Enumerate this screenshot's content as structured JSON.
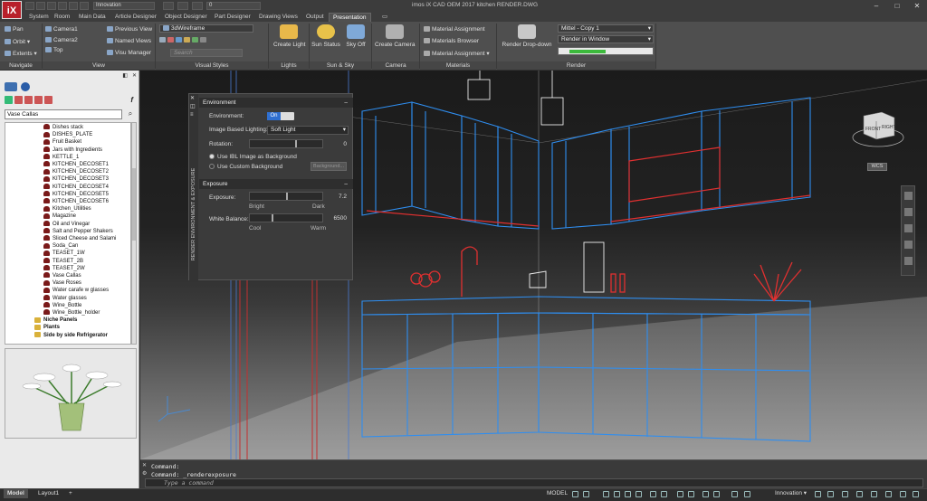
{
  "title_bar": {
    "app_logo": "iX",
    "workspace_dropdown": "Innovation",
    "layer_dropdown": "0",
    "title": "imos iX CAD OEM 2017   kitchen RENDER.DWG"
  },
  "ribbon_tabs": [
    "System",
    "Room",
    "Main Data",
    "Article Designer",
    "Object Designer",
    "Part Designer",
    "Drawing Views",
    "Output",
    "Presentation"
  ],
  "ribbon": {
    "navigate": {
      "pan": "Pan",
      "orbit": "Orbit",
      "extents": "Extents",
      "label": "Navigate"
    },
    "view": {
      "camera1": "Camera1",
      "camera2": "Camera2",
      "top": "Top",
      "previous_view": "Previous View",
      "named_views": "Named Views",
      "visu_manager": "Visu Manager",
      "label": "View"
    },
    "visual_styles": {
      "style": "3dWireframe",
      "search_placeholder": "Search",
      "label": "Visual Styles"
    },
    "lights": {
      "create_light": "Create Light",
      "label": "Lights"
    },
    "sun_sky": {
      "sun_status": "Sun Status",
      "sky_off": "Sky Off",
      "label": "Sun & Sky"
    },
    "camera": {
      "create_camera": "Create Camera",
      "label": "Camera"
    },
    "materials": {
      "assignment": "Material Assignment",
      "browser": "Materials Browser",
      "assignment2": "Material Assignment",
      "label": "Materials"
    },
    "render": {
      "render_dropdown": "Render Drop-down",
      "preset": "Mittel - Copy 1",
      "target": "Render in Window",
      "label": "Render"
    }
  },
  "left_panel": {
    "search_value": "Vase Callas",
    "tree_items": [
      "Dishes stack",
      "DISHES_PLATE",
      "Fruit Basket",
      "Jars with Ingredients",
      "KETTLE_1",
      "KITCHEN_DECOSET1",
      "KITCHEN_DECOSET2",
      "KITCHEN_DECOSET3",
      "KITCHEN_DECOSET4",
      "KITCHEN_DECOSET5",
      "KITCHEN_DECOSET6",
      "Kitchen_Utilities",
      "Magazine",
      "Oil and Vinegar",
      "Salt and Pepper Shakers",
      "Sliced Cheese and Salami",
      "Soda_Can",
      "TEASET_1W",
      "TEASET_2B",
      "TEASET_2W",
      "Vase Callas",
      "Vase Roses",
      "Water carafe w glasses",
      "Water glasses",
      "Wine_Bottle",
      "Wine_Bottle_holder"
    ],
    "tree_folders": [
      "Niche Panels",
      "Plants",
      "Side by side Refrigerator"
    ]
  },
  "render_panel": {
    "side_title": "RENDER ENVIRONMENT & EXPOSURE",
    "environment_header": "Environment",
    "environment_label": "Environment:",
    "environment_toggle": "On",
    "ibl_label": "Image Based Lighting:",
    "ibl_value": "Soft Light",
    "rotation_label": "Rotation:",
    "rotation_value": "0",
    "use_ibl_bg": "Use IBL Image as Background",
    "use_custom_bg": "Use Custom Background",
    "background_btn": "Background...",
    "exposure_header": "Exposure",
    "exposure_label": "Exposure:",
    "exposure_value": "7.2",
    "bright_label": "Bright",
    "dark_label": "Dark",
    "white_balance_label": "White Balance:",
    "white_balance_value": "6500",
    "cool_label": "Cool",
    "warm_label": "Warm"
  },
  "viewcube": {
    "front": "FRONT",
    "right": "RIGHT",
    "ucs": "WCS"
  },
  "command": {
    "line1": "Command:",
    "line2": "Command: _renderexposure",
    "placeholder": "Type a command"
  },
  "status_bar": {
    "model_tab": "Model",
    "layout_tab": "Layout1",
    "add_tab": "+",
    "model_indicator": "MODEL",
    "workspace": "Innovation"
  }
}
